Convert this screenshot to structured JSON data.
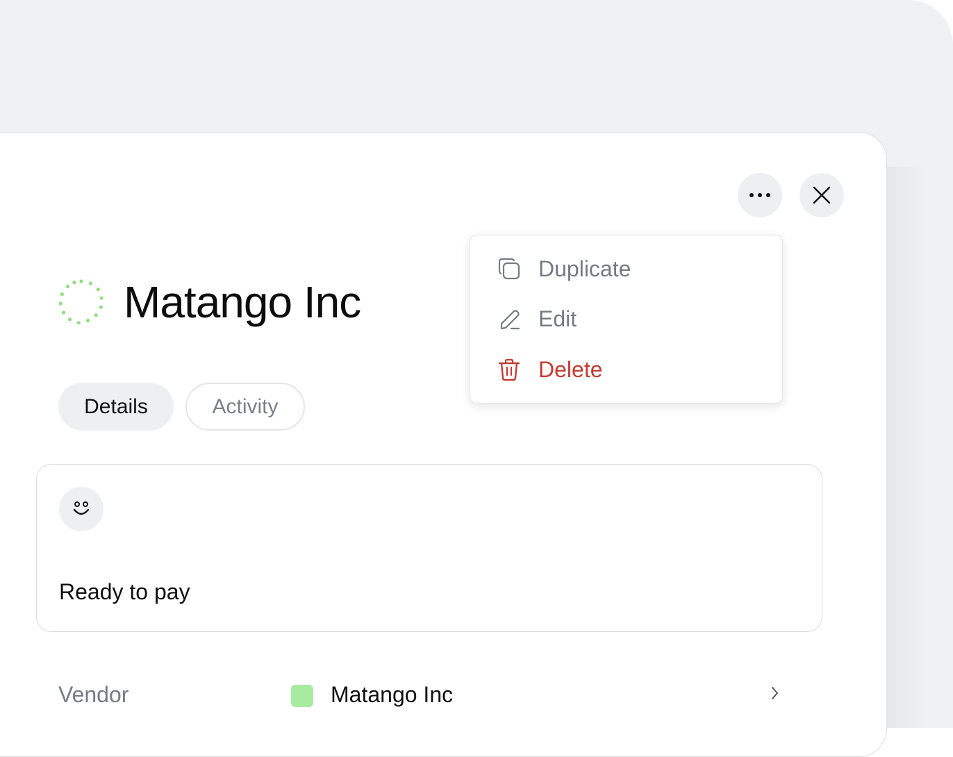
{
  "panel": {
    "title": "Matango Inc",
    "status_icon": "dotted-circle-icon",
    "header_actions": {
      "more_icon": "ellipsis-icon",
      "close_icon": "close-icon"
    }
  },
  "tabs": [
    {
      "label": "Details",
      "selected": true
    },
    {
      "label": "Activity",
      "selected": false
    }
  ],
  "status_card": {
    "icon": "smiley-icon",
    "text": "Ready to pay"
  },
  "fields": {
    "vendor": {
      "label": "Vendor",
      "value": "Matango Inc",
      "swatch_color": "#a8eaa0"
    }
  },
  "menu": {
    "items": [
      {
        "label": "Duplicate",
        "icon": "duplicate-icon"
      },
      {
        "label": "Edit",
        "icon": "pencil-icon"
      },
      {
        "label": "Delete",
        "icon": "trash-icon",
        "color": "#c33b32"
      }
    ]
  },
  "colors": {
    "accent_green": "#8fe07f",
    "danger": "#c33b32",
    "muted_text": "#767b83"
  }
}
